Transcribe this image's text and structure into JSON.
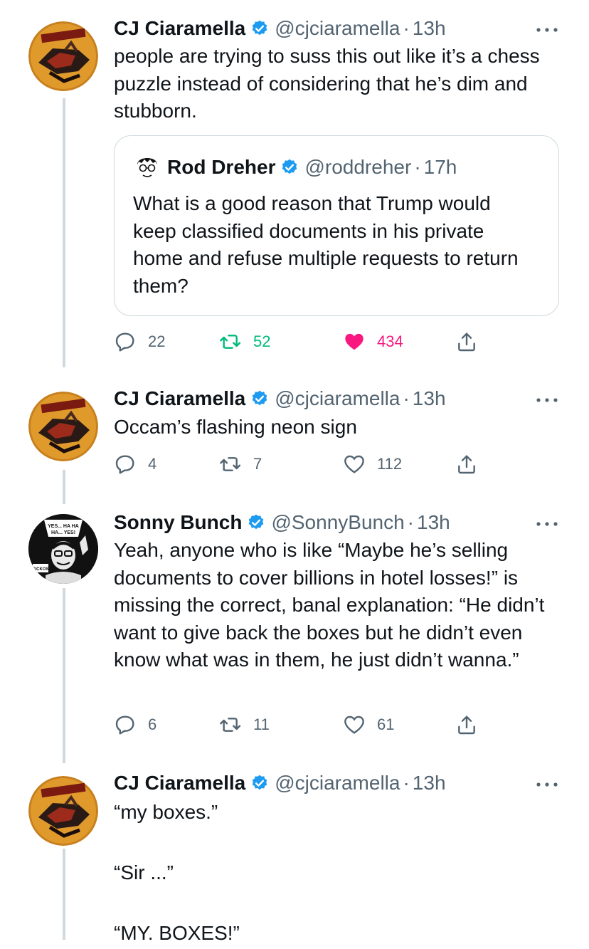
{
  "colors": {
    "accent": "#1d9bf0",
    "muted": "#536471",
    "retweet_active": "#00ba7c",
    "like_active": "#f91880",
    "line": "#cfd9de"
  },
  "tweets": [
    {
      "name": "CJ Ciaramella",
      "handle": "@cjciaramella",
      "separator": "·",
      "time": "13h",
      "text": "people are trying to suss this out like it’s a chess puzzle instead of considering that he’s dim and stubborn.",
      "quote": {
        "name": "Rod Dreher",
        "handle": "@roddreher",
        "separator": "·",
        "time": "17h",
        "text": "What is a good reason that Trump would keep classified documents in his private home and refuse multiple requests to return them?"
      },
      "replies": "22",
      "retweets": "52",
      "likes": "434"
    },
    {
      "name": "CJ Ciaramella",
      "handle": "@cjciaramella",
      "separator": "·",
      "time": "13h",
      "text": "Occam’s flashing neon sign",
      "replies": "4",
      "retweets": "7",
      "likes": "112"
    },
    {
      "name": "Sonny Bunch",
      "handle": "@SonnyBunch",
      "separator": "·",
      "time": "13h",
      "avatar_text": {
        "top": "YES... HA HA",
        "mid": "HA... YES!",
        "tag": "SICKOS"
      },
      "text": "Yeah, anyone who is like “Maybe he’s selling documents to cover billions in hotel losses!” is missing the correct, banal explanation: “He didn’t want to give back the boxes but he didn’t even know what was in them, he just didn’t wanna.”",
      "replies": "6",
      "retweets": "11",
      "likes": "61"
    },
    {
      "name": "CJ Ciaramella",
      "handle": "@cjciaramella",
      "separator": "·",
      "time": "13h",
      "text": "“my boxes.”\n\n“Sir ...”\n\n“MY. BOXES!”"
    }
  ],
  "icons": {
    "reply": "reply-icon",
    "retweet": "retweet-icon",
    "like": "heart-icon",
    "share": "share-icon",
    "more": "more-icon",
    "verified": "verified-badge-icon"
  }
}
